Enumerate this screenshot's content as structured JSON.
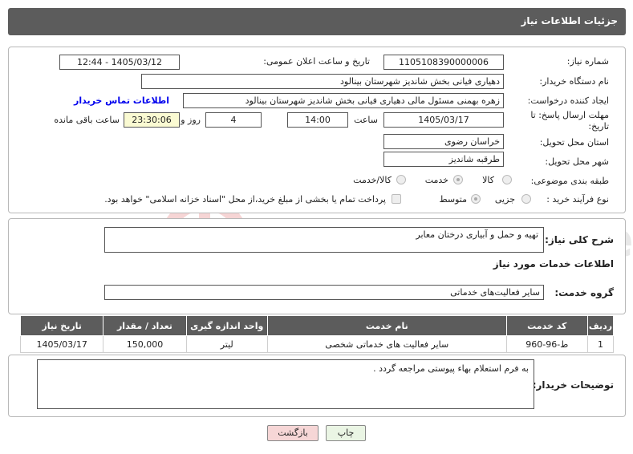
{
  "header": {
    "title": "جزئیات اطلاعات نیاز"
  },
  "fields": {
    "need_number_label": "شماره نیاز:",
    "need_number": "1105108390000006",
    "announce_label": "تاریخ و ساعت اعلان عمومی:",
    "announce_value": "1405/03/12 - 12:44",
    "buyer_org_label": "نام دستگاه خریدار:",
    "buyer_org": "دهیاری فیانی بخش شاندیز شهرستان بینالود",
    "creator_label": "ایجاد کننده درخواست:",
    "creator": "زهره بهمنی مسئول مالی دهیاری فیانی بخش شاندیز شهرستان بینالود",
    "contact_link": "اطلاعات تماس خریدار",
    "deadline_label": "مهلت ارسال پاسخ: تا تاریخ:",
    "deadline_date": "1405/03/17",
    "time_label": "ساعت",
    "deadline_time": "14:00",
    "days_value": "4",
    "days_label": "روز و",
    "remaining_time": "23:30:06",
    "remaining_label": "ساعت باقی مانده",
    "province_label": "استان محل تحویل:",
    "province": "خراسان رضوی",
    "city_label": "شهر محل تحویل:",
    "city": "طرقبه شاندیز",
    "category_label": "طبقه بندی موضوعی:",
    "category_options": [
      "کالا",
      "خدمت",
      "کالا/خدمت"
    ],
    "process_label": "نوع فرآیند خرید :",
    "process_options": [
      "جزیی",
      "متوسط"
    ],
    "payment_note": "پرداخت تمام یا بخشی از مبلغ خرید،از محل \"اسناد خزانه اسلامی\" خواهد بود."
  },
  "summary": {
    "label": "شرح کلی نیاز:",
    "text": "تهیه و حمل و آبیاری درختان معابر"
  },
  "services": {
    "section_title": "اطلاعات خدمات مورد نیاز",
    "group_label": "گروه خدمت:",
    "group_value": "سایر فعالیت‌های خدماتی",
    "headers": [
      "ردیف",
      "کد خدمت",
      "نام خدمت",
      "واحد اندازه گیری",
      "تعداد / مقدار",
      "تاریخ نیاز"
    ],
    "rows": [
      [
        "1",
        "ط-96-960",
        "سایر فعالیت های خدماتی شخصی",
        "لیتر",
        "150,000",
        "1405/03/17"
      ]
    ]
  },
  "buyer_notes": {
    "label": "توضیحات خریدار:",
    "text": "به فرم استعلام بهاء پیوستی مراجعه گردد ."
  },
  "buttons": {
    "print": "چاپ",
    "back": "بازگشت"
  },
  "watermark": {
    "text": "AriaTender.net"
  },
  "colors": {
    "header_bg": "#5c5c5c",
    "link": "#0000ee",
    "back_btn_bg": "#f6d6d6",
    "print_btn_bg": "#eaf5e4"
  }
}
